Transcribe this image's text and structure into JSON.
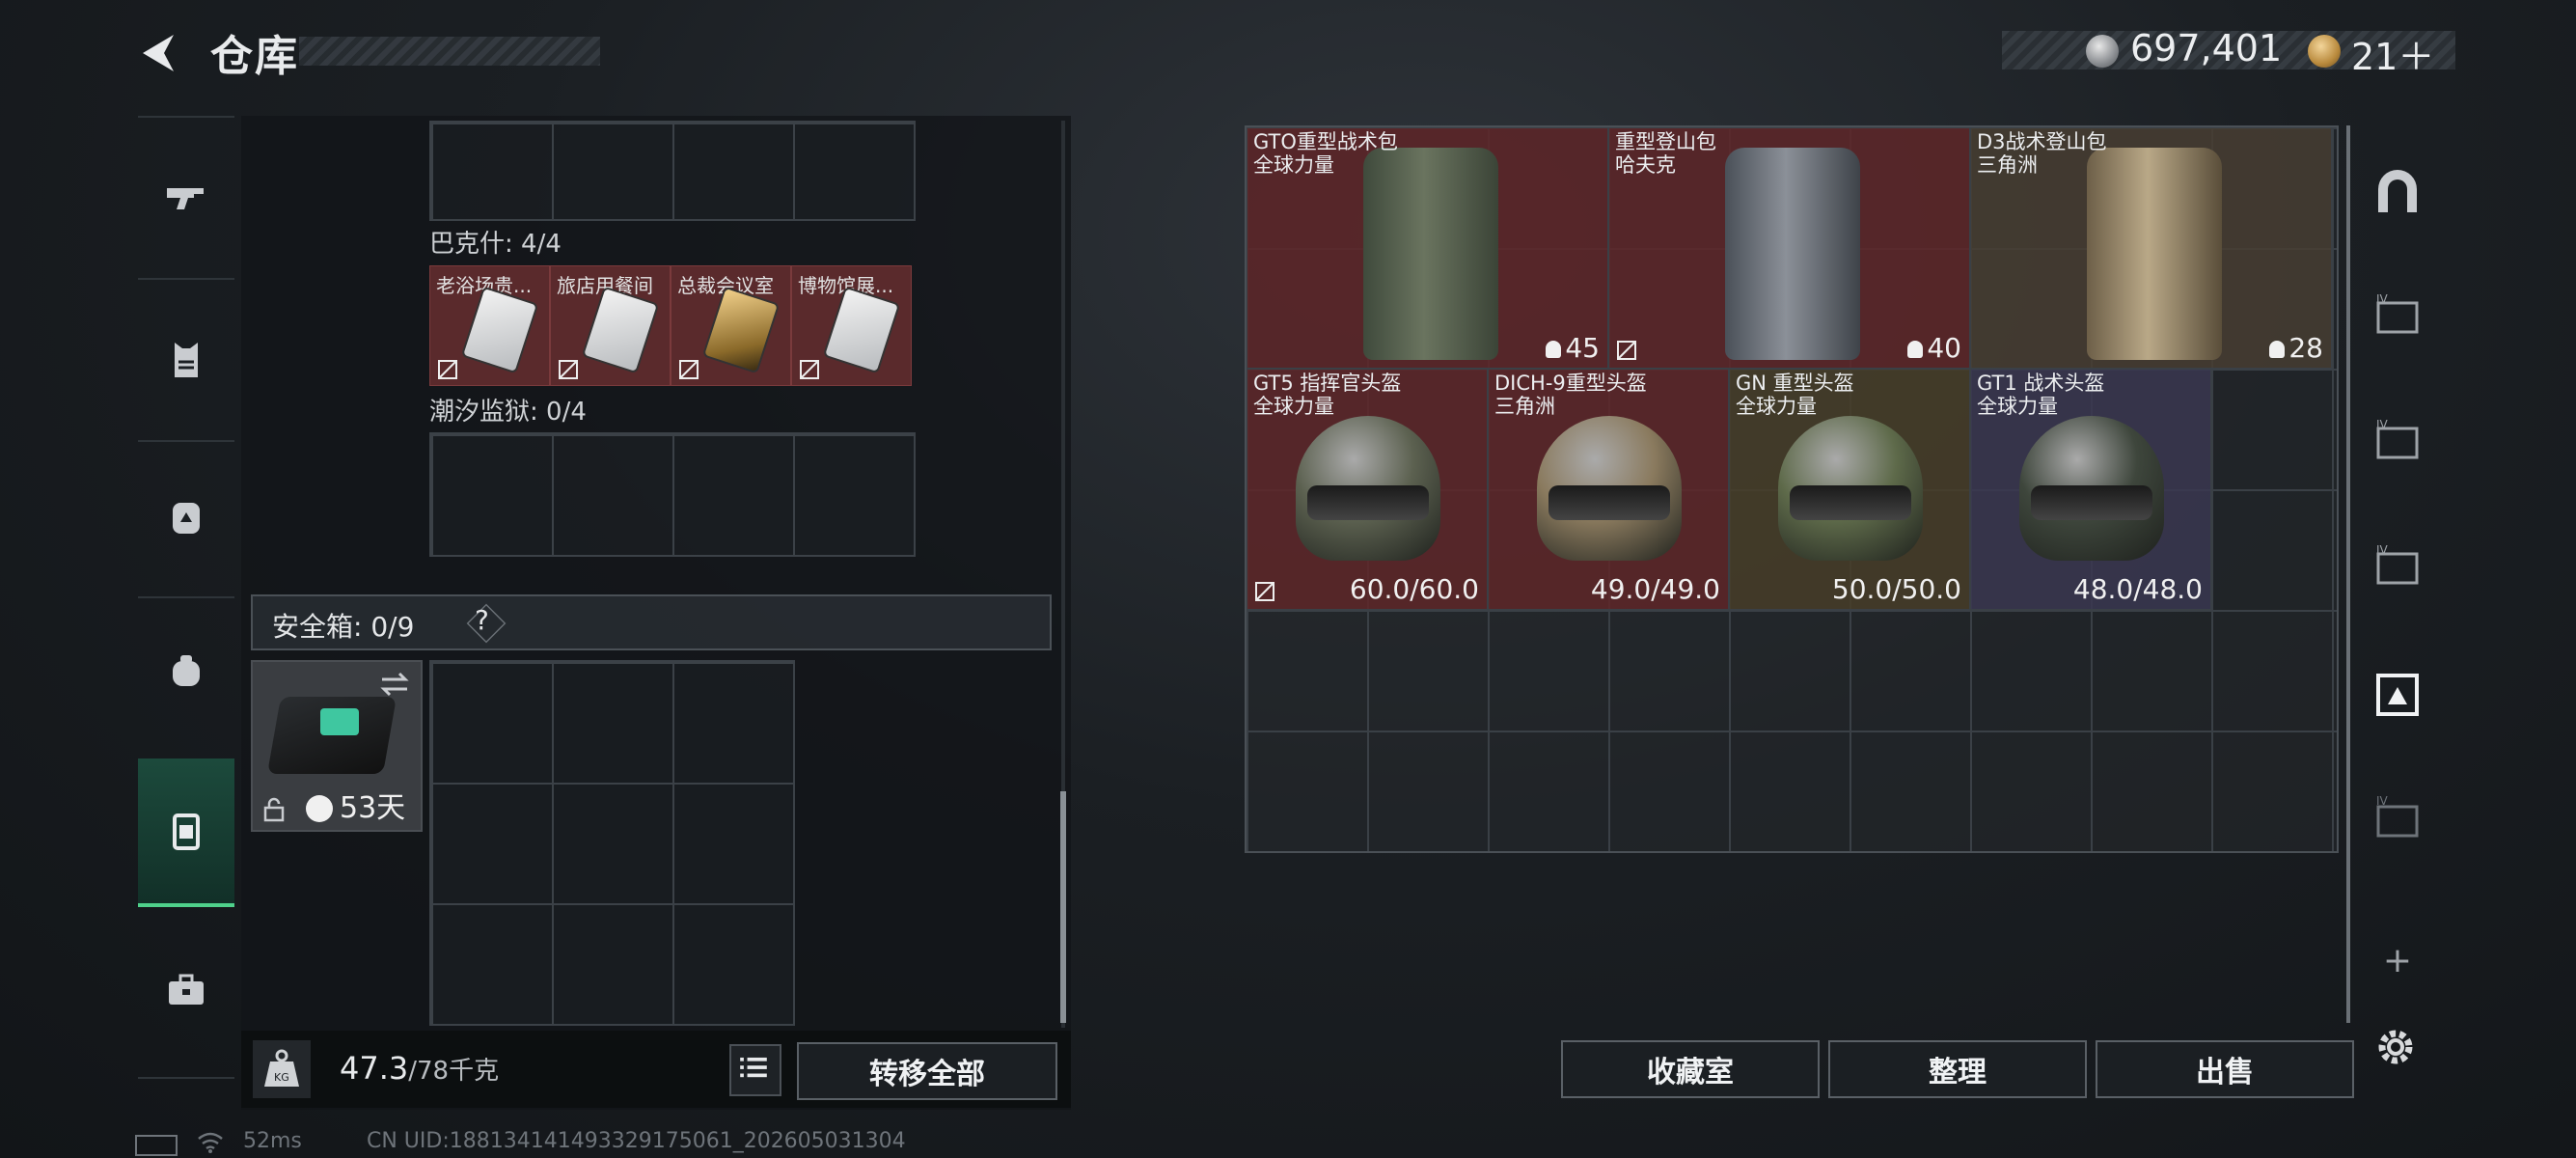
{
  "header": {
    "title": "仓库",
    "money": "697,401",
    "tickets": "21＋"
  },
  "storage": {
    "bakesh_label": "巴克什: 4/4",
    "bakesh_keys": [
      {
        "name": "老浴场贵...",
        "variant": "silver"
      },
      {
        "name": "旅店用餐间",
        "variant": "silver"
      },
      {
        "name": "总裁会议室",
        "variant": "gold"
      },
      {
        "name": "博物馆展...",
        "variant": "silver"
      }
    ],
    "tidal_label": "潮汐监狱: 0/4",
    "safe_label": "安全箱: 0/9",
    "help": "?",
    "safe_days": "53天",
    "weight_value": "47.3",
    "weight_max": "/78千克",
    "transfer_all": "转移全部"
  },
  "items": [
    {
      "line1": "GTO重型战术包",
      "line2": "全球力量",
      "stat": "45",
      "kind": "bag",
      "bag_color": "green",
      "color": "#602628"
    },
    {
      "line1": "重型登山包",
      "line2": "哈夫克",
      "stat": "40",
      "kind": "bag",
      "bag_color": "grey",
      "color": "#602628"
    },
    {
      "line1": "D3战术登山包",
      "line2": "三角洲",
      "stat": "28",
      "kind": "bag",
      "bag_color": "tan",
      "color": "#483e32"
    },
    {
      "line1": "GT5 指挥官头盔",
      "line2": "全球力量",
      "stat": "60.0/60.0",
      "kind": "helmet"
    },
    {
      "line1": "DICH-9重型头盔",
      "line2": "三角洲",
      "stat": "49.0/49.0",
      "kind": "helmet"
    },
    {
      "line1": "GN 重型头盔",
      "line2": "全球力量",
      "stat": "50.0/50.0",
      "kind": "helmet"
    },
    {
      "line1": "GT1 战术头盔",
      "line2": "全球力量",
      "stat": "48.0/48.0",
      "kind": "helmet"
    }
  ],
  "buttons": {
    "collection": "收藏室",
    "organize": "整理",
    "sell": "出售"
  },
  "status": {
    "ping": "52ms",
    "uid": "CN UID:188134141493329175061_202605031304"
  },
  "right_nav": {
    "add": "+"
  }
}
